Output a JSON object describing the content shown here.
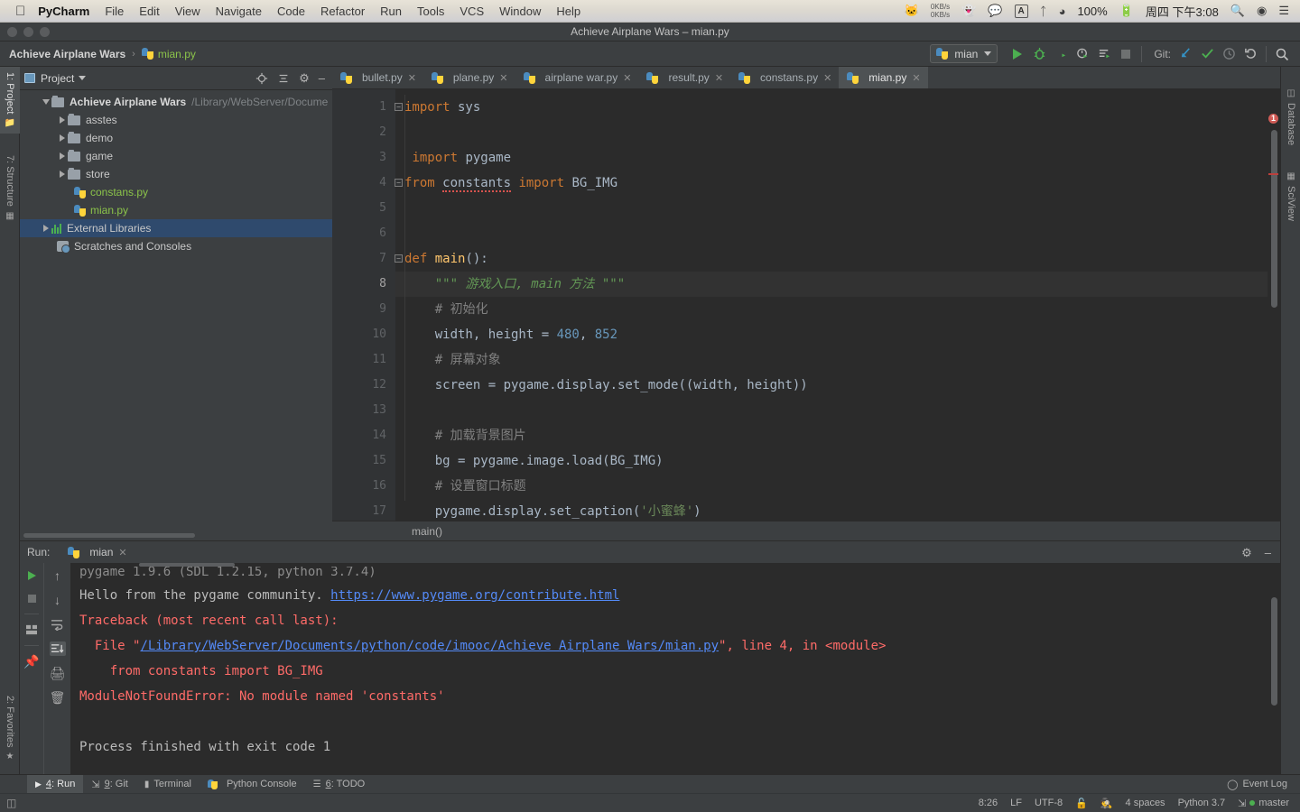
{
  "mac_menu": {
    "apple_icon": "apple-icon",
    "items": [
      "PyCharm",
      "File",
      "Edit",
      "View",
      "Navigate",
      "Code",
      "Refactor",
      "Run",
      "Tools",
      "VCS",
      "Window",
      "Help"
    ],
    "status": {
      "net_up": "0KB/s",
      "net_down": "0KB/s",
      "icons": [
        "cat-icon",
        "qq-icon",
        "wechat-icon",
        "input-method-icon",
        "bluetooth-icon",
        "wifi-icon"
      ],
      "input_method": "A",
      "battery": "100%",
      "battery_icon": "battery-charging-icon",
      "datetime": "周四 下午3:08",
      "search_icon": "spotlight-search-icon",
      "siri_icon": "siri-icon",
      "control_center_icon": "notification-center-icon"
    }
  },
  "window": {
    "title": "Achieve Airplane Wars – mian.py"
  },
  "toolbar": {
    "breadcrumb": {
      "project": "Achieve Airplane Wars",
      "separator": "›",
      "file": "mian.py"
    },
    "run_config": "mian",
    "buttons": [
      "run-button",
      "debug-button",
      "run-coverage-button",
      "profile-button",
      "run-with-console-button",
      "stop-button"
    ],
    "git_label": "Git:",
    "git_buttons": [
      "update-project-button",
      "commit-button",
      "history-button",
      "rollback-button"
    ],
    "search_icon": "search-everywhere-icon"
  },
  "left_strip": [
    {
      "label": "1: Project",
      "active": true,
      "icon": "project-icon"
    },
    {
      "label": "7: Structure",
      "active": false,
      "icon": "structure-icon"
    },
    {
      "label": "2: Favorites",
      "active": false,
      "icon": "star-icon"
    }
  ],
  "right_strip": [
    {
      "label": "Database",
      "icon": "database-icon"
    },
    {
      "label": "SciView",
      "icon": "sciview-icon"
    }
  ],
  "project_panel": {
    "title": "Project",
    "header_icons": [
      "locate-icon",
      "collapse-all-icon",
      "gear-icon",
      "hide-icon"
    ],
    "tree": [
      {
        "label": "Achieve Airplane Wars",
        "path": "/Library/WebServer/Docume",
        "type": "root",
        "expanded": true,
        "indent": 0,
        "selected": false
      },
      {
        "label": "asstes",
        "type": "folder",
        "expanded": false,
        "indent": 1,
        "selected": false
      },
      {
        "label": "demo",
        "type": "folder",
        "expanded": false,
        "indent": 1,
        "selected": false
      },
      {
        "label": "game",
        "type": "folder",
        "expanded": false,
        "indent": 1,
        "selected": false
      },
      {
        "label": "store",
        "type": "folder",
        "expanded": false,
        "indent": 1,
        "selected": false
      },
      {
        "label": "constans.py",
        "type": "python",
        "indent": 1,
        "selected": false
      },
      {
        "label": "mian.py",
        "type": "python",
        "indent": 1,
        "selected": false
      },
      {
        "label": "External Libraries",
        "type": "library",
        "expanded": false,
        "indent": 0,
        "selected": true
      },
      {
        "label": "Scratches and Consoles",
        "type": "scratch",
        "indent": 0,
        "selected": false
      }
    ]
  },
  "editor": {
    "tabs": [
      {
        "label": "bullet.py",
        "active": false
      },
      {
        "label": "plane.py",
        "active": false
      },
      {
        "label": "airplane war.py",
        "active": false
      },
      {
        "label": "result.py",
        "active": false
      },
      {
        "label": "constans.py",
        "active": false
      },
      {
        "label": "mian.py",
        "active": true
      }
    ],
    "close_icon": "close-tab-icon",
    "breadcrumb": "main()",
    "error_badge": "1",
    "lines": [
      {
        "n": "1",
        "current": false,
        "fold": "minus"
      },
      {
        "n": "2",
        "current": false
      },
      {
        "n": "3",
        "current": false
      },
      {
        "n": "4",
        "current": false,
        "fold": "minus"
      },
      {
        "n": "5",
        "current": false
      },
      {
        "n": "6",
        "current": false
      },
      {
        "n": "7",
        "current": false,
        "fold": "minus"
      },
      {
        "n": "8",
        "current": true
      },
      {
        "n": "9",
        "current": false
      },
      {
        "n": "10",
        "current": false
      },
      {
        "n": "11",
        "current": false
      },
      {
        "n": "12",
        "current": false
      },
      {
        "n": "13",
        "current": false
      },
      {
        "n": "14",
        "current": false
      },
      {
        "n": "15",
        "current": false
      },
      {
        "n": "16",
        "current": false
      },
      {
        "n": "17",
        "current": false
      }
    ],
    "code": {
      "l1_kw": "import",
      "l1_mod": " sys",
      "l3_kw": "import",
      "l3_mod": " pygame",
      "l4_from": "from",
      "l4_mod": "constants",
      "l4_import": "import",
      "l4_name": "BG_IMG",
      "l7_def": "def",
      "l7_name": "main",
      "l7_tail": "():",
      "l8_doc": "\"\"\" 游戏入口, main 方法 \"\"\"",
      "l9_cmt": "# 初始化",
      "l10_a": "width, height = ",
      "l10_n1": "480",
      "l10_sep": ", ",
      "l10_n2": "852",
      "l11_cmt": "# 屏幕对象",
      "l12": "screen = pygame.display.set_mode((width, height))",
      "l14_cmt": "# 加载背景图片",
      "l15": "bg = pygame.image.load(BG_IMG)",
      "l16_cmt": "# 设置窗口标题",
      "l17_a": "pygame.display.set_caption(",
      "l17_str": "'小蜜蜂'",
      "l17_b": ")"
    }
  },
  "run_panel": {
    "label": "Run:",
    "tab": "mian",
    "tab_close_icon": "close-icon",
    "header_icons": [
      "settings-gear-icon",
      "hide-panel-icon"
    ],
    "tool_icons": [
      "rerun-button",
      "stop-button",
      "restore-layout-button",
      "pin-tab-button"
    ],
    "tool_icons2": [
      "prev-occurrence-button",
      "next-occurrence-button",
      "soft-wrap-button",
      "scroll-to-end-button",
      "print-button",
      "clear-all-button"
    ],
    "console": {
      "line1_partial": "pygame 1.9.6 (SDL 1.2.15, python 3.7.4)",
      "line2_a": "Hello from the pygame community. ",
      "line2_link": "https://www.pygame.org/contribute.html",
      "line3": "Traceback (most recent call last):",
      "line4_a": "  File \"",
      "line4_link": "/Library/WebServer/Documents/python/code/imooc/Achieve Airplane Wars/mian.py",
      "line4_b": "\", line 4, in <module>",
      "line5": "    from constants import BG_IMG",
      "line6": "ModuleNotFoundError: No module named 'constants'",
      "line7": "Process finished with exit code 1"
    }
  },
  "tool_window_bar": {
    "tabs": [
      {
        "num": "4",
        "label": ": Run",
        "icon": "run-icon",
        "active": true
      },
      {
        "num": "9",
        "label": ": Git",
        "icon": "git-icon",
        "active": false
      },
      {
        "num": "",
        "label": "Terminal",
        "icon": "terminal-icon",
        "active": false
      },
      {
        "num": "",
        "label": "Python Console",
        "icon": "python-console-icon",
        "active": false
      },
      {
        "num": "6",
        "label": ": TODO",
        "icon": "todo-icon",
        "active": false
      }
    ],
    "event_log": "Event Log",
    "event_log_icon": "event-log-icon"
  },
  "status_bar": {
    "left_icon": "toggle-toolbar-icon",
    "caret": "8:26",
    "line_separator": "LF",
    "encoding": "UTF-8",
    "lock_icon": "lock-icon",
    "hector_icon": "hector-inspection-icon",
    "indent": "4 spaces",
    "interpreter": "Python 3.7",
    "branch": "master",
    "branch_icon": "git-branch-icon"
  },
  "colors": {
    "accent_blue": "#2f4a6d",
    "keyword_orange": "#cc7832",
    "string_green": "#6a8759",
    "number_blue": "#6897bb",
    "error_red": "#ff6b68",
    "link_blue": "#548af7",
    "python_green": "#8bc34a"
  }
}
